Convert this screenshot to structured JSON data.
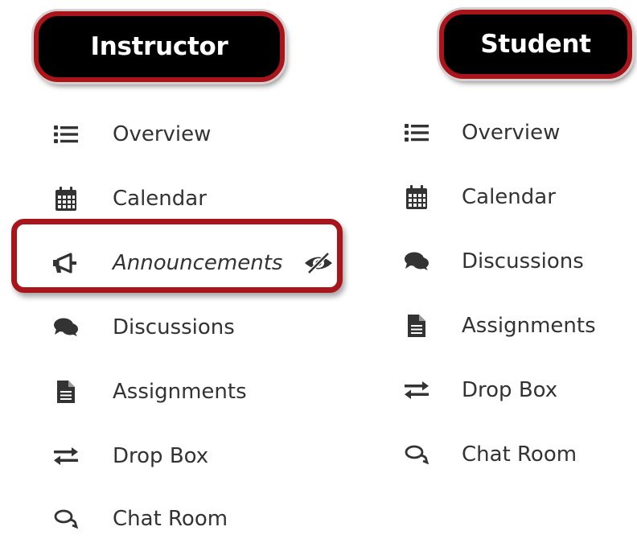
{
  "instructor": {
    "header": "Instructor",
    "items": [
      {
        "label": "Overview",
        "icon": "list-icon"
      },
      {
        "label": "Calendar",
        "icon": "calendar-icon"
      },
      {
        "label": "Announcements",
        "icon": "megaphone-icon",
        "hidden": true,
        "status_icon": "eye-slash-icon"
      },
      {
        "label": "Discussions",
        "icon": "comments-icon"
      },
      {
        "label": "Assignments",
        "icon": "file-text-icon"
      },
      {
        "label": "Drop Box",
        "icon": "exchange-icon"
      },
      {
        "label": "Chat Room",
        "icon": "chat-outline-icon"
      }
    ]
  },
  "student": {
    "header": "Student",
    "items": [
      {
        "label": "Overview",
        "icon": "list-icon"
      },
      {
        "label": "Calendar",
        "icon": "calendar-icon"
      },
      {
        "label": "Discussions",
        "icon": "comments-icon"
      },
      {
        "label": "Assignments",
        "icon": "file-text-icon"
      },
      {
        "label": "Drop Box",
        "icon": "exchange-icon"
      },
      {
        "label": "Chat Room",
        "icon": "chat-outline-icon"
      }
    ]
  },
  "colors": {
    "highlight_border": "#a8161c",
    "pill_background": "#000000",
    "icon": "#333333",
    "text": "#333333"
  }
}
